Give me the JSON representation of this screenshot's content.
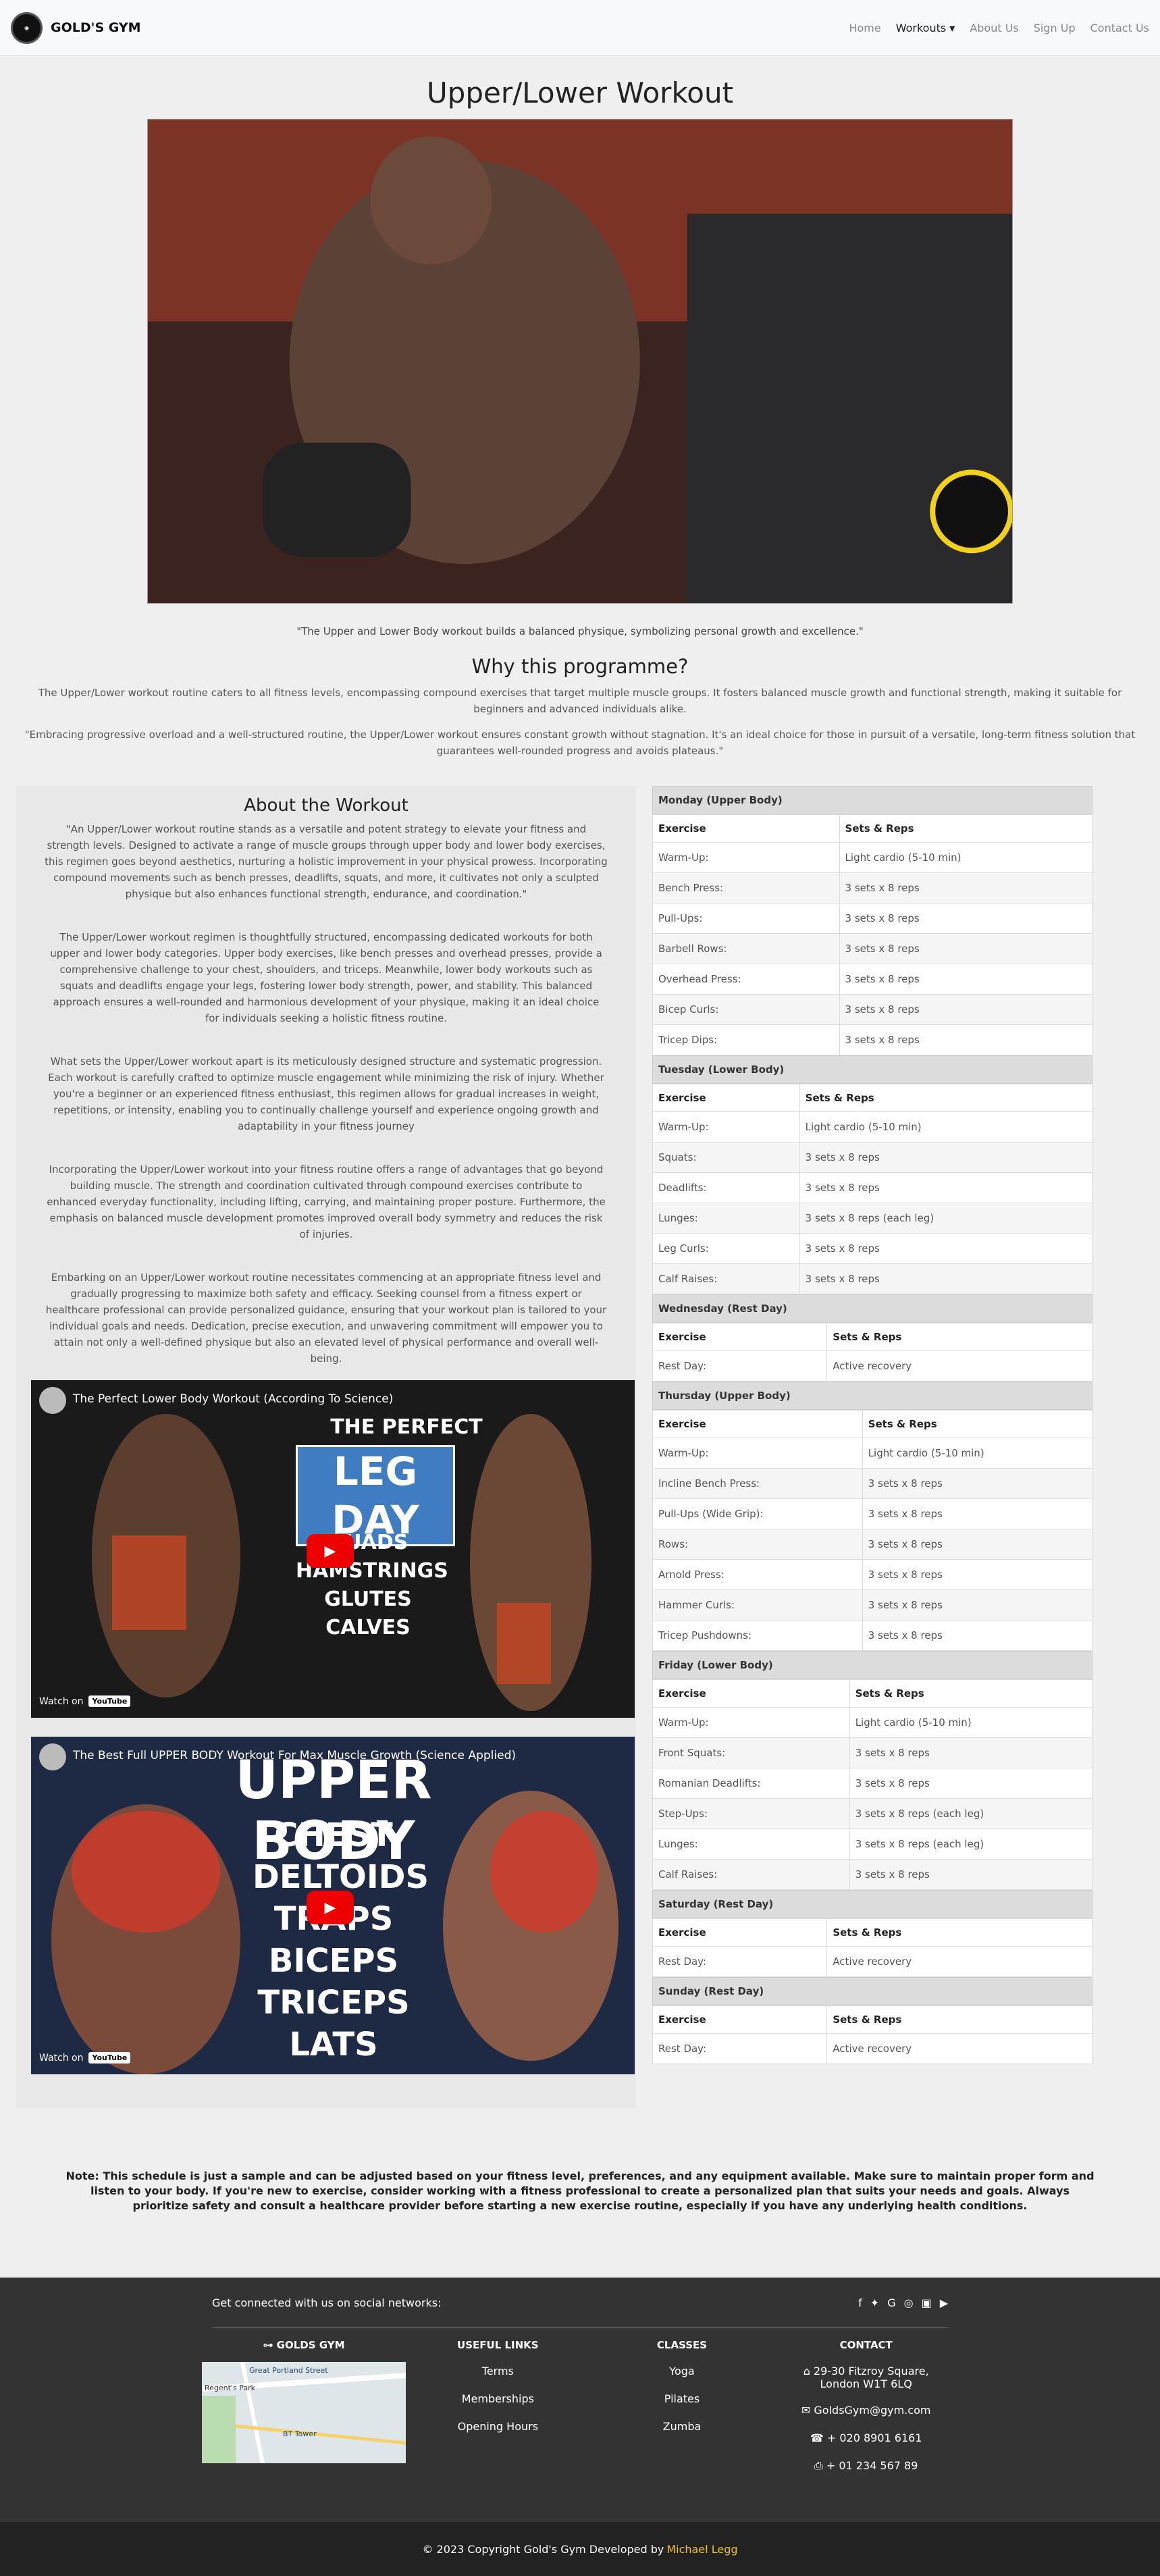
{
  "navbar": {
    "brand": "GOLD'S GYM",
    "links": [
      "Home",
      "Workouts",
      "About Us",
      "Sign Up",
      "Contact Us"
    ],
    "dropdown_indicator": "▾"
  },
  "page": {
    "title": "Upper/Lower Workout",
    "caption": "\"The Upper and Lower Body workout builds a balanced physique, symbolizing personal growth and excellence.\"",
    "why_title": "Why this programme?",
    "why_text1": "The Upper/Lower workout routine caters to all fitness levels, encompassing compound exercises that target multiple muscle groups. It fosters balanced muscle growth and functional strength, making it suitable for beginners and advanced individuals alike.",
    "why_text2": "\"Embracing progressive overload and a well-structured routine, the Upper/Lower workout ensures constant growth without stagnation. It's an ideal choice for those in pursuit of a versatile, long-term fitness solution that guarantees well-rounded progress and avoids plateaus.\""
  },
  "about": {
    "title": "About the Workout",
    "paragraphs": [
      "\"An Upper/Lower workout routine stands as a versatile and potent strategy to elevate your fitness and strength levels. Designed to activate a range of muscle groups through upper body and lower body exercises, this regimen goes beyond aesthetics, nurturing a holistic improvement in your physical prowess. Incorporating compound movements such as bench presses, deadlifts, squats, and more, it cultivates not only a sculpted physique but also enhances functional strength, endurance, and coordination.\"",
      "The Upper/Lower workout regimen is thoughtfully structured, encompassing dedicated workouts for both upper and lower body categories. Upper body exercises, like bench presses and overhead presses, provide a comprehensive challenge to your chest, shoulders, and triceps. Meanwhile, lower body workouts such as squats and deadlifts engage your legs, fostering lower body strength, power, and stability. This balanced approach ensures a well-rounded and harmonious development of your physique, making it an ideal choice for individuals seeking a holistic fitness routine.",
      "What sets the Upper/Lower workout apart is its meticulously designed structure and systematic progression. Each workout is carefully crafted to optimize muscle engagement while minimizing the risk of injury. Whether you're a beginner or an experienced fitness enthusiast, this regimen allows for gradual increases in weight, repetitions, or intensity, enabling you to continually challenge yourself and experience ongoing growth and adaptability in your fitness journey",
      "Incorporating the Upper/Lower workout into your fitness routine offers a range of advantages that go beyond building muscle. The strength and coordination cultivated through compound exercises contribute to enhanced everyday functionality, including lifting, carrying, and maintaining proper posture. Furthermore, the emphasis on balanced muscle development promotes improved overall body symmetry and reduces the risk of injuries.",
      "Embarking on an Upper/Lower workout routine necessitates commencing at an appropriate fitness level and gradually progressing to maximize both safety and efficacy. Seeking counsel from a fitness expert or healthcare professional can provide personalized guidance, ensuring that your workout plan is tailored to your individual goals and needs. Dedication, precise execution, and unwavering commitment will empower you to attain not only a well-defined physique but also an elevated level of physical performance and overall well-being."
    ]
  },
  "videos": [
    {
      "title": "The Perfect Lower Body Workout (According To Science)",
      "thumb_heading": "THE PERFECT",
      "thumb_big": "LEG DAY",
      "thumb_list": [
        "QUADS",
        "HAMSTRINGS",
        "GLUTES",
        "CALVES"
      ]
    },
    {
      "title": "The Best Full UPPER BODY Workout For Max Muscle Growth (Science Applied)",
      "thumb_big": "UPPER BODY",
      "thumb_list": [
        "CHEST",
        "DELTOIDS",
        "TRAPS",
        "BICEPS",
        "TRICEPS",
        "LATS"
      ]
    }
  ],
  "video_watch": {
    "label": "Watch on",
    "logo": "YouTube"
  },
  "schedule": {
    "col_exercise": "Exercise",
    "col_sets": "Sets & Reps",
    "days": [
      {
        "name": "Monday (Upper Body)",
        "rows": [
          [
            "Warm-Up:",
            "Light cardio (5-10 min)"
          ],
          [
            "Bench Press:",
            "3 sets x 8 reps"
          ],
          [
            "Pull-Ups:",
            "3 sets x 8 reps"
          ],
          [
            "Barbell Rows:",
            "3 sets x 8 reps"
          ],
          [
            "Overhead Press:",
            "3 sets x 8 reps"
          ],
          [
            "Bicep Curls:",
            "3 sets x 8 reps"
          ],
          [
            "Tricep Dips:",
            "3 sets x 8 reps"
          ]
        ]
      },
      {
        "name": "Tuesday (Lower Body)",
        "rows": [
          [
            "Warm-Up:",
            "Light cardio (5-10 min)"
          ],
          [
            "Squats:",
            "3 sets x 8 reps"
          ],
          [
            "Deadlifts:",
            "3 sets x 8 reps"
          ],
          [
            "Lunges:",
            "3 sets x 8 reps (each leg)"
          ],
          [
            "Leg Curls:",
            "3 sets x 8 reps"
          ],
          [
            "Calf Raises:",
            "3 sets x 8 reps"
          ]
        ]
      },
      {
        "name": "Wednesday (Rest Day)",
        "rows": [
          [
            "Rest Day:",
            "Active recovery"
          ]
        ]
      },
      {
        "name": "Thursday (Upper Body)",
        "rows": [
          [
            "Warm-Up:",
            "Light cardio (5-10 min)"
          ],
          [
            "Incline Bench Press:",
            "3 sets x 8 reps"
          ],
          [
            "Pull-Ups (Wide Grip):",
            "3 sets x 8 reps"
          ],
          [
            "Rows:",
            "3 sets x 8 reps"
          ],
          [
            "Arnold Press:",
            "3 sets x 8 reps"
          ],
          [
            "Hammer Curls:",
            "3 sets x 8 reps"
          ],
          [
            "Tricep Pushdowns:",
            "3 sets x 8 reps"
          ]
        ]
      },
      {
        "name": "Friday (Lower Body)",
        "rows": [
          [
            "Warm-Up:",
            "Light cardio (5-10 min)"
          ],
          [
            "Front Squats:",
            "3 sets x 8 reps"
          ],
          [
            "Romanian Deadlifts:",
            "3 sets x 8 reps"
          ],
          [
            "Step-Ups:",
            "3 sets x 8 reps (each leg)"
          ],
          [
            "Lunges:",
            "3 sets x 8 reps (each leg)"
          ],
          [
            "Calf Raises:",
            "3 sets x 8 reps"
          ]
        ]
      },
      {
        "name": "Saturday (Rest Day)",
        "rows": [
          [
            "Rest Day:",
            "Active recovery"
          ]
        ]
      },
      {
        "name": "Sunday (Rest Day)",
        "rows": [
          [
            "Rest Day:",
            "Active recovery"
          ]
        ]
      }
    ]
  },
  "note": "Note: This schedule is just a sample and can be adjusted based on your fitness level, preferences, and any equipment available. Make sure to maintain proper form and listen to your body. If you're new to exercise, consider working with a fitness professional to create a personalized plan that suits your needs and goals. Always prioritize safety and consult a healthcare provider before starting a new exercise routine, especially if you have any underlying health conditions.",
  "footer": {
    "social_text": "Get connected with us on social networks:",
    "gym_title": "GOLDS GYM",
    "useful_title": "USEFUL LINKS",
    "useful": [
      "Terms",
      "Memberships",
      "Opening Hours"
    ],
    "classes_title": "CLASSES",
    "classes": [
      "Yoga",
      "Pilates",
      "Zumba"
    ],
    "contact_title": "CONTACT",
    "address": "29-30 Fitzroy Square, London W1T 6LQ",
    "email": "GoldsGym@gym.com",
    "phone": "+ 020 8901 6161",
    "fax": "+ 01 234 567 89",
    "map_labels": [
      "Great Portland Street",
      "Regent's Park",
      "BT Tower"
    ],
    "copyright": "© 2023 Copyright Gold's Gym Developed by",
    "author": "Michael Legg"
  }
}
